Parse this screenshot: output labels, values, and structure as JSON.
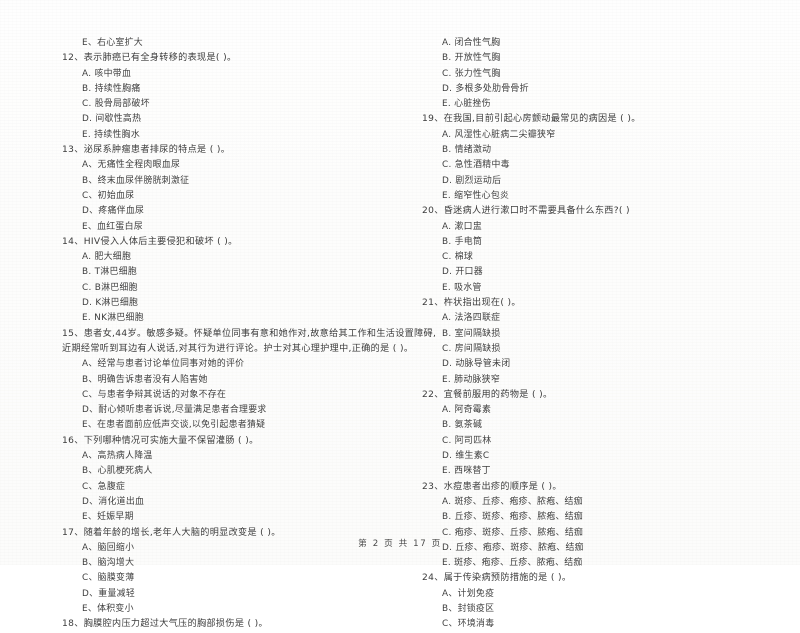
{
  "document": {
    "type": "exam-paper-scan",
    "footer": "第 2 页 共 17 页"
  },
  "left_column": {
    "leading_option": "E、右心室扩大",
    "questions": [
      {
        "stem": "12、表示肺癌已有全身转移的表现是(        )。",
        "options": [
          "A. 咳中带血",
          "B. 持续性胸痛",
          "C. 股骨局部破坏",
          "D. 间歇性高热",
          "E. 持续性胸水"
        ]
      },
      {
        "stem": "13、泌尿系肿瘤患者排尿的特点是 (      )。",
        "options": [
          "A、无痛性全程肉眼血尿",
          "B、终末血尿伴膀胱刺激征",
          "C、初始血尿",
          "D、疼痛伴血尿",
          "E、血红蛋白尿"
        ]
      },
      {
        "stem": "14、HIV侵入人体后主要侵犯和破坏 (      )。",
        "options": [
          "A. 肥大细胞",
          "B. T淋巴细胞",
          "C. B淋巴细胞",
          "D. K淋巴细胞",
          "E. NK淋巴细胞"
        ]
      },
      {
        "stem": "15、患者女,44岁。敏感多疑。怀疑单位同事有意和她作对,故意给其工作和生活设置障碍,",
        "stem_cont": "近期经常听到耳边有人说话,对其行为进行评论。护士对其心理护理中,正确的是 (      )。",
        "options": [
          "A、经常与患者讨论单位同事对她的评价",
          "B、明确告诉患者没有人陷害她",
          "C、与患者争辩其说话的对象不存在",
          "D、耐心倾听患者诉说,尽量满足患者合理要求",
          "E、在患者面前应低声交谈,以免引起患者猜疑"
        ]
      },
      {
        "stem": "16、下列哪种情况可实施大量不保留灌肠 (      )。",
        "options": [
          "A、高热病人降温",
          "B、心肌梗死病人",
          "C、急腹症",
          "D、消化道出血",
          "E、妊娠早期"
        ]
      },
      {
        "stem": "17、随着年龄的增长,老年人大脑的明显改变是 (      )。",
        "options": [
          "A、脑回缩小",
          "B、脑沟增大",
          "C、脑膜变薄",
          "D、重量减轻",
          "E、体积变小"
        ]
      },
      {
        "stem": "18、胸膜腔内压力超过大气压的胸部损伤是 (      )。",
        "options": []
      }
    ]
  },
  "right_column": {
    "continued_options": [
      "A. 闭合性气胸",
      "B. 开放性气胸",
      "C. 张力性气胸",
      "D. 多根多处肋骨骨折",
      "E. 心脏挫伤"
    ],
    "questions": [
      {
        "stem": "19、在我国,目前引起心房颤动最常见的病因是 (      )。",
        "options": [
          "A. 风湿性心脏病二尖瓣狭窄",
          "B. 情绪激动",
          "C. 急性酒精中毒",
          "D. 剧烈运动后",
          "E. 缩窄性心包炎"
        ]
      },
      {
        "stem": "20、昏迷病人进行漱口时不需要具备什么东西?(        )",
        "options": [
          "A. 漱口盅",
          "B. 手电筒",
          "C. 棉球",
          "D. 开口器",
          "E. 吸水管"
        ]
      },
      {
        "stem": "21、杵状指出现在(        )。",
        "options": [
          "A. 法洛四联症",
          "B. 室间隔缺损",
          "C. 房间隔缺损",
          "D. 动脉导管未闭",
          "E. 肺动脉狭窄"
        ]
      },
      {
        "stem": "22、宜餐前服用的药物是 (      )。",
        "options": [
          "A. 阿奇霉素",
          "B. 氨茶碱",
          "C. 阿司匹林",
          "D. 维生素C",
          "E. 西咪替丁"
        ]
      },
      {
        "stem": "23、水痘患者出疹的顺序是 (      )。",
        "options": [
          "A. 斑疹、丘疹、疱疹、脓疱、结痂",
          "B. 丘疹、斑疹、疱疹、脓疱、结痂",
          "C. 疱疹、斑疹、丘疹、脓疱、结痂",
          "D. 丘疹、疱疹、斑疹、脓疱、结痂",
          "E. 斑疹、疱疹、丘疹、脓疱、结痂"
        ]
      },
      {
        "stem": "24、属于传染病预防措施的是 (      )。",
        "options": [
          "A、计划免疫",
          "B、封锁疫区",
          "C、环境消毒"
        ]
      }
    ]
  }
}
